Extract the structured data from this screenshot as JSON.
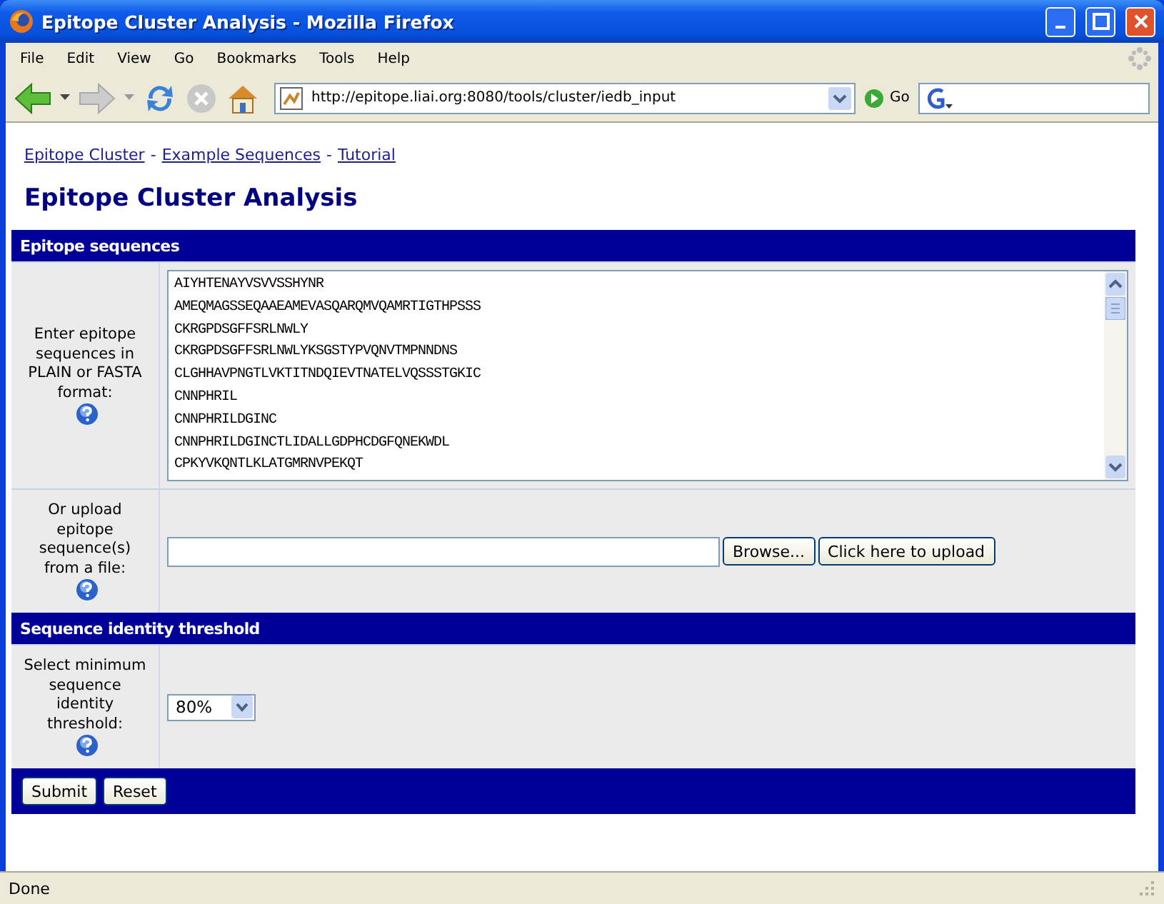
{
  "window": {
    "title": "Epitope Cluster Analysis - Mozilla Firefox"
  },
  "menu": [
    "File",
    "Edit",
    "View",
    "Go",
    "Bookmarks",
    "Tools",
    "Help"
  ],
  "toolbar": {
    "url": "http://epitope.liai.org:8080/tools/cluster/iedb_input",
    "go_label": "Go"
  },
  "breadcrumbs": [
    "Epitope Cluster",
    "Example Sequences",
    "Tutorial"
  ],
  "breadcrumb_separator": "-",
  "heading": "Epitope Cluster Analysis",
  "sections": [
    {
      "header": "Epitope sequences",
      "rows": [
        {
          "kind": "textarea",
          "label": "Enter epitope sequences in PLAIN or FASTA format:",
          "lines": [
            "AIYHTENAYVSVVSSHYNR",
            "AMEQMAGSSEQAAEAMEVASQARQMVQAMRTIGTHPSSS",
            "CKRGPDSGFFSRLNWLY",
            "CKRGPDSGFFSRLNWLYKSGSTYPVQNVTMPNNDNS",
            "CLGHHAVPNGTLVKTITNDQIEVTNATELVQSSSTGKIC",
            "CNNPHRIL",
            "CNNPHRILDGINC",
            "CNNPHRILDGINCTLIDALLGDPHCDGFQNEKWDL",
            "CPKYVKQNTLKLATGMRNVPEKQT"
          ]
        },
        {
          "kind": "upload",
          "label": "Or upload epitope sequence(s) from a file:",
          "browse": "Browse...",
          "upload": "Click here to upload"
        }
      ]
    },
    {
      "header": "Sequence identity threshold",
      "rows": [
        {
          "kind": "select",
          "label": "Select minimum sequence identity threshold:",
          "value": "80%"
        }
      ]
    }
  ],
  "actions": [
    "Submit",
    "Reset"
  ],
  "status_bar": {
    "text": "Done"
  }
}
